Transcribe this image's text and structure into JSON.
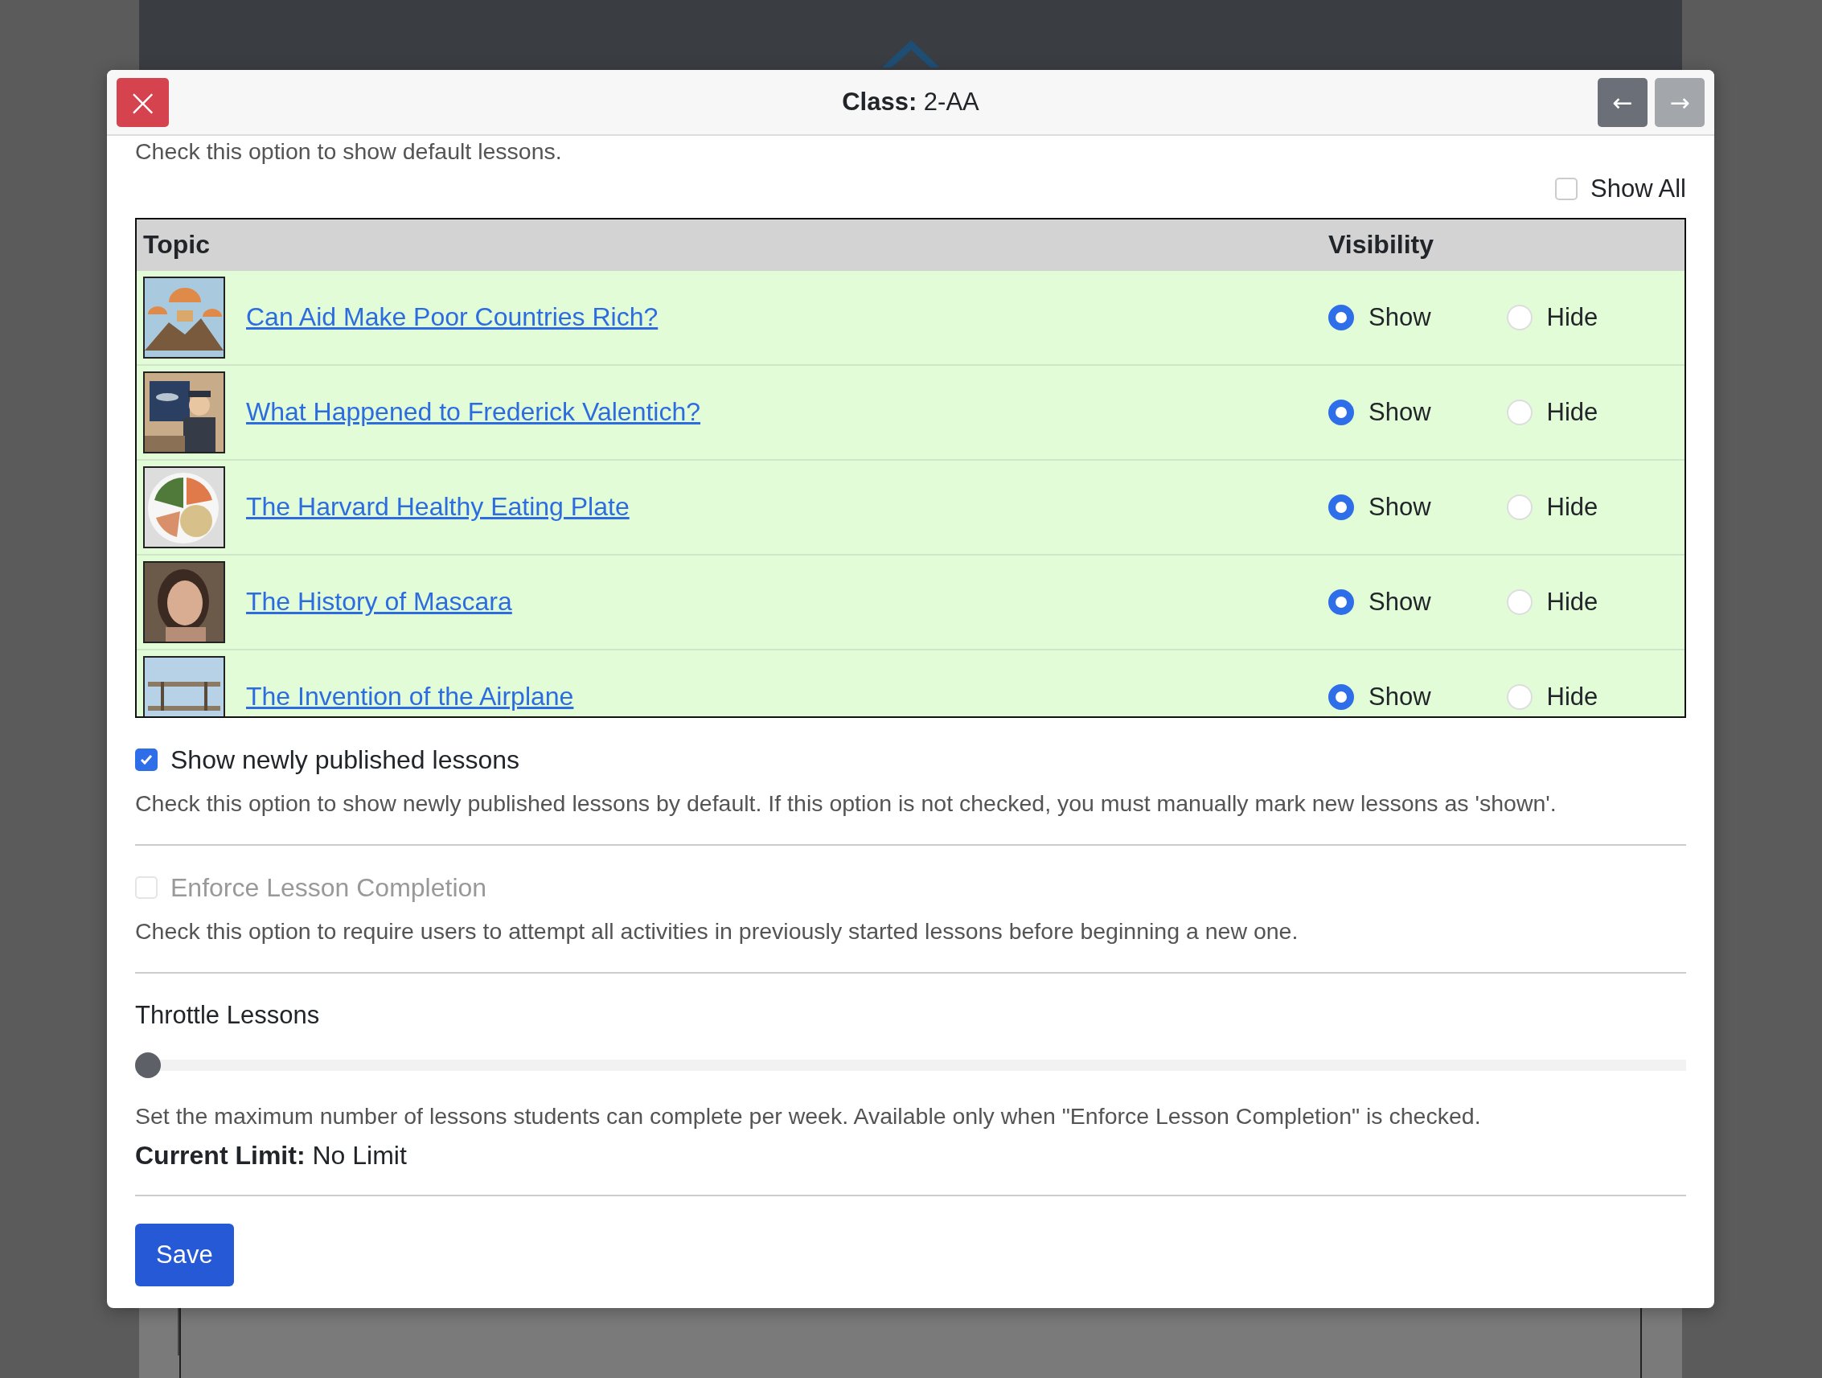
{
  "dialog": {
    "title": "**Class:** 2-AA",
    "close": "×",
    "nav": [
      {
        "label": "←",
        "disabled": false
      },
      {
        "label": "→",
        "disabled": true
      }
    ]
  },
  "intro": "Check this option to show default lessons.",
  "show_all": {
    "label": "Show All",
    "checked": false
  },
  "table": {
    "columns": [
      "Topic",
      "Visibility"
    ],
    "rows": [
      {
        "title": "Can Aid Make Poor Countries Rich?",
        "options": [
          {
            "label": "Show",
            "selected": true
          },
          {
            "label": "Hide",
            "selected": false
          }
        ]
      },
      {
        "title": "What Happened to Frederick Valentich?",
        "options": [
          {
            "label": "Show",
            "selected": true
          },
          {
            "label": "Hide",
            "selected": false
          }
        ]
      },
      {
        "title": "The Harvard Healthy Eating Plate",
        "options": [
          {
            "label": "Show",
            "selected": true
          },
          {
            "label": "Hide",
            "selected": false
          }
        ]
      },
      {
        "title": "The History of Mascara",
        "options": [
          {
            "label": "Show",
            "selected": true
          },
          {
            "label": "Hide",
            "selected": false
          }
        ]
      },
      {
        "title": "The Invention of the Airplane",
        "options": [
          {
            "label": "Show",
            "selected": true
          },
          {
            "label": "Hide",
            "selected": false
          }
        ]
      }
    ]
  },
  "settings": [
    {
      "kind": "checkbox",
      "label": "Show newly published lessons",
      "checked": true,
      "disabled": false,
      "help": "Check this option to show newly published lessons by default. If this option is not checked, you must manually mark new lessons as 'shown'."
    },
    {
      "kind": "checkbox",
      "label": "Enforce Lesson Completion",
      "checked": false,
      "disabled": true,
      "help": "Check this option to require users to attempt all activities in previously started lessons before beginning a new one."
    },
    {
      "kind": "slider",
      "label": "Throttle Lessons",
      "level": 0,
      "help": "Set the maximum number of lessons students can complete per week. Available only when \"Enforce Lesson Completion\" is checked.",
      "reading": "**Current Limit:** No Limit"
    }
  ],
  "save": "Save"
}
